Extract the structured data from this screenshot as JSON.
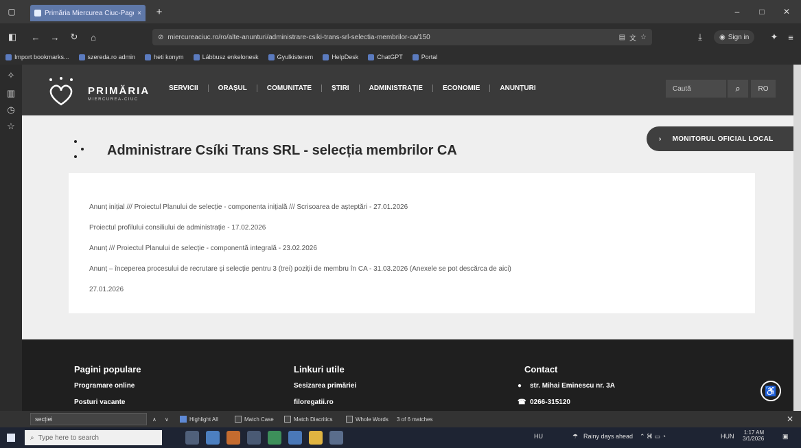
{
  "browser": {
    "tab_title": "Primăria Miercurea Ciuc-Page X",
    "new_tab_symbol": "+",
    "url": "miercureaciuc.ro/ro/alte-anunturi/administrare-csiki-trans-srl-selectia-membrilor-ca/150",
    "sign_in": "Sign in",
    "bookmarks": [
      "Import bookmarks...",
      "szereda.ro admin",
      "heti konym",
      "Lábbusz enkelonesk",
      "Gyulkisterem",
      "HelpDesk",
      "ChatGPT",
      "Portal"
    ]
  },
  "site": {
    "brand_name": "PRIMĂRIA",
    "brand_sub": "MIERCUREA-CIUC",
    "menu": [
      "SERVICII",
      "ORAȘUL",
      "COMUNITATE",
      "ȘTIRI",
      "ADMINISTRAȚIE",
      "ECONOMIE",
      "ANUNȚURI"
    ],
    "search_placeholder": "Caută",
    "lang": "RO",
    "monitor_button": "MONITORUL OFICIAL LOCAL",
    "page_title": "Administrare Csíki Trans SRL - selecția membrilor CA",
    "lines": [
      "Anunț inițial /// Proiectul Planului de selecție - componenta inițială /// Scrisoarea de așteptări - 27.01.2026",
      "Proiectul profilului consiliului de administrație - 17.02.2026",
      "Anunț /// Proiectul Planului de selecție - componentă integrală - 23.02.2026",
      "Anunț – începerea procesului de recrutare și selecție pentru 3 (trei) poziții de membru în CA - 31.03.2026 (Anexele se pot descărca de aici)",
      "27.01.2026"
    ],
    "footer": {
      "col1_title": "Pagini populare",
      "col1_items": [
        "Programare online",
        "Posturi vacante"
      ],
      "col2_title": "Linkuri utile",
      "col2_items": [
        "Sesizarea primăriei",
        "filoregatii.ro"
      ],
      "col3_title": "Contact",
      "col3_items": [
        "str. Mihai Eminescu nr. 3A",
        "0266-315120"
      ]
    }
  },
  "findbar": {
    "query": "secției",
    "highlight_all": "Highlight All",
    "match_case": "Match Case",
    "match_diacritics": "Match Diacritics",
    "whole_words": "Whole Words",
    "result": "3 of 6 matches"
  },
  "taskbar": {
    "search_placeholder": "Type here to search",
    "weather": "Rainy days ahead",
    "lang": "HU",
    "lang2": "HUN",
    "time": "1:17 AM",
    "date": "3/1/2026"
  }
}
